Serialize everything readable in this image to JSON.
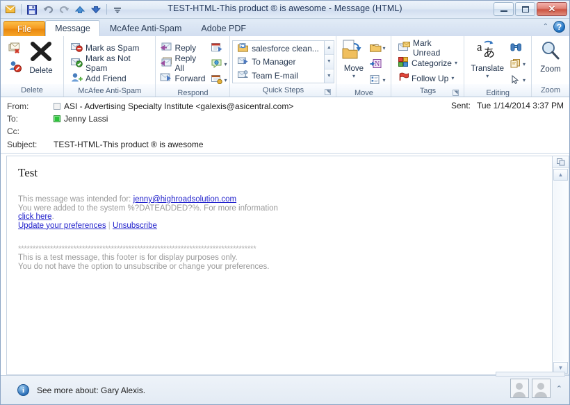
{
  "window": {
    "title": "TEST-HTML-This product ® is awesome  -  Message (HTML)",
    "minimize_label": "Minimize",
    "maximize_label": "Restore Down",
    "close_label": "✕"
  },
  "quick_access_toolbar": {
    "items": [
      {
        "name": "envelope-icon",
        "label": "Envelope"
      },
      {
        "name": "save-icon",
        "label": "Save"
      },
      {
        "name": "undo-icon",
        "label": "Undo"
      },
      {
        "name": "redo-icon",
        "label": "Redo"
      },
      {
        "name": "previous-item-icon",
        "label": "Previous Item"
      },
      {
        "name": "next-item-icon",
        "label": "Next Item"
      },
      {
        "name": "customize-quick-access-icon",
        "label": "Customize Quick Access Toolbar"
      }
    ]
  },
  "tabs": [
    {
      "label": "File",
      "state": "file"
    },
    {
      "label": "Message",
      "state": "active"
    },
    {
      "label": "McAfee Anti-Spam",
      "state": "normal"
    },
    {
      "label": "Adobe PDF",
      "state": "normal"
    }
  ],
  "tab_row_right": {
    "collapse_ribbon_label": "⌃",
    "help_label": "?"
  },
  "ribbon": {
    "groups": [
      {
        "title": "Delete",
        "buttons": [
          {
            "label": "",
            "icon": "ignore-icon"
          },
          {
            "label": "",
            "icon": "junk-icon"
          },
          {
            "label": "Delete",
            "icon": "delete-x-icon"
          }
        ]
      },
      {
        "title": "McAfee Anti-Spam",
        "buttons": [
          {
            "label": "Mark as Spam",
            "icon": "mark-as-spam-icon"
          },
          {
            "label": "Mark as Not Spam",
            "icon": "mark-as-not-spam-icon"
          },
          {
            "label": "Add Friend",
            "icon": "add-friend-icon"
          }
        ]
      },
      {
        "title": "Respond",
        "buttons": [
          {
            "label": "Reply",
            "icon": "reply-icon"
          },
          {
            "label": "Reply All",
            "icon": "reply-all-icon"
          },
          {
            "label": "Forward",
            "icon": "forward-icon"
          },
          {
            "label": "",
            "icon": "meeting-icon"
          },
          {
            "label": "",
            "icon": "im-icon"
          },
          {
            "label": "",
            "icon": "more-respond-icon"
          }
        ]
      },
      {
        "title": "Quick Steps",
        "items": [
          {
            "label": "salesforce clean...",
            "icon": "quick-step-salesforce-icon"
          },
          {
            "label": "To Manager",
            "icon": "quick-step-to-manager-icon"
          },
          {
            "label": "Team E-mail",
            "icon": "quick-step-team-email-icon"
          }
        ],
        "has_dialog_launcher": true
      },
      {
        "title": "Move",
        "buttons": [
          {
            "label": "Move",
            "icon": "move-folder-icon"
          },
          {
            "label": "",
            "icon": "rules-icon"
          },
          {
            "label": "",
            "icon": "onenote-icon"
          },
          {
            "label": "",
            "icon": "actions-icon"
          }
        ]
      },
      {
        "title": "Tags",
        "buttons": [
          {
            "label": "Mark Unread",
            "icon": "mark-unread-icon"
          },
          {
            "label": "Categorize",
            "icon": "categorize-icon"
          },
          {
            "label": "Follow Up",
            "icon": "follow-up-flag-icon"
          }
        ],
        "has_dialog_launcher": true
      },
      {
        "title": "Editing",
        "buttons": [
          {
            "label": "Translate",
            "icon": "translate-icon"
          },
          {
            "label": "",
            "icon": "find-binoculars-icon"
          },
          {
            "label": "",
            "icon": "related-icon"
          },
          {
            "label": "",
            "icon": "select-pointer-icon"
          }
        ]
      },
      {
        "title": "Zoom",
        "buttons": [
          {
            "label": "Zoom",
            "icon": "zoom-magnifier-icon"
          }
        ]
      }
    ]
  },
  "header": {
    "from_label": "From:",
    "from_value": "ASI - Advertising Specialty Institute <galexis@asicentral.com>",
    "from_presence": "none",
    "to_label": "To:",
    "to_value": "Jenny Lassi",
    "to_presence": "green",
    "cc_label": "Cc:",
    "cc_value": "",
    "subject_label": "Subject:",
    "subject_value": "TEST-HTML-This product ® is awesome",
    "sent_label": "Sent:",
    "sent_value": "Tue 1/14/2014 3:37 PM"
  },
  "message_body": {
    "heading": "Test",
    "line1_prefix": "This message was intended for: ",
    "line1_link": "jenny@highroadsolution.com",
    "line2": "You were added to the system %?DATEADDED?%. For more information",
    "line3_link": "click here",
    "line3_suffix": ".",
    "link_update": "Update your preferences",
    "link_divider": "|",
    "link_unsubscribe": "Unsubscribe",
    "divider_stars": "**********************************************************************************",
    "footer_line1": "This is a test message, this footer is for display purposes only.",
    "footer_line2": "You do not have the option to unsubscribe or change your preferences."
  },
  "scrollbar": {
    "split_label": "Split",
    "up_label": "▲",
    "down_label": "▼"
  },
  "status_bar": {
    "info_icon_label": "i",
    "text": "See more about: Gary Alexis.",
    "avatar1_label": "Contact photo",
    "avatar2_label": "Contact photo",
    "expand_label": "⌃"
  },
  "colors": {
    "file_tab": "#f5971d",
    "accent_blue": "#2a6fb8",
    "link": "#2222cc",
    "body_text_gray": "#9a9a9a",
    "presence_green": "#2cc23a",
    "close_button_red": "#cc5341"
  }
}
